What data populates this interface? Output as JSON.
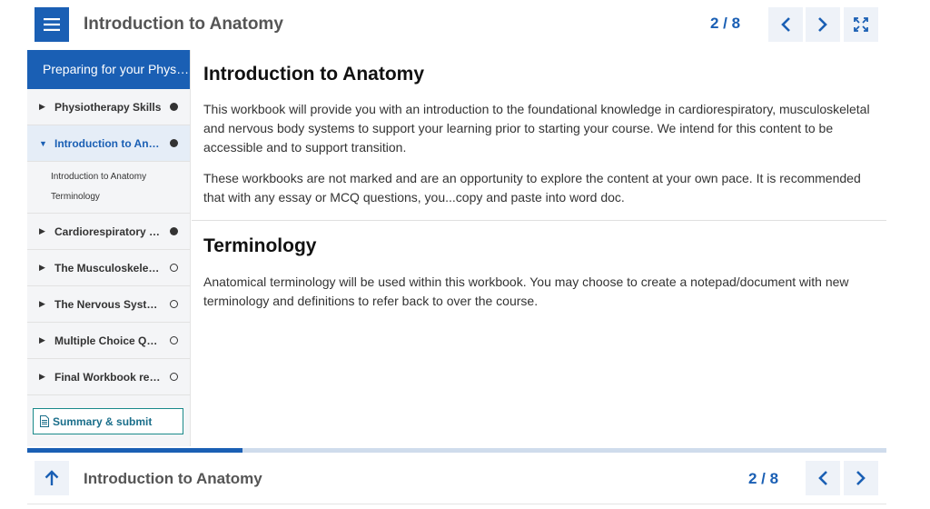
{
  "header": {
    "title": "Introduction to Anatomy",
    "counter": "2 / 8"
  },
  "sidebar": {
    "heading": "Preparing for your Physiotherapy degree",
    "items": [
      {
        "label": "Physiotherapy Skills",
        "status": "complete",
        "expanded": false
      },
      {
        "label": "Introduction to Anatomy",
        "status": "complete",
        "expanded": true,
        "active": true
      },
      {
        "label": "Cardiorespiratory System",
        "status": "complete",
        "expanded": false
      },
      {
        "label": "The Musculoskeletal System",
        "status": "incomplete",
        "expanded": false
      },
      {
        "label": "The Nervous System",
        "status": "incomplete",
        "expanded": false
      },
      {
        "label": "Multiple Choice Questions",
        "status": "incomplete",
        "expanded": false
      },
      {
        "label": "Final Workbook reflection",
        "status": "incomplete",
        "expanded": false
      }
    ],
    "subitems": [
      "Introduction to Anatomy",
      "Terminology"
    ],
    "summary_label": "Summary & submit"
  },
  "content": {
    "section1": {
      "heading": "Introduction to Anatomy",
      "p1": "This workbook will provide you with an introduction to the foundational knowledge in cardiorespiratory, musculoskeletal and nervous body systems to support your learning prior to starting your course. We intend for this content to be accessible and to support transition.",
      "p2": "These workbooks are not marked and are an opportunity to explore the content at your own pace. It is recommended that with any essay or MCQ questions, you...copy and paste into word doc."
    },
    "section2": {
      "heading": "Terminology",
      "p1": "Anatomical terminology will be used within this workbook. You may choose to create a notepad/document with new terminology and definitions to refer back to over the course."
    }
  },
  "progress": {
    "value": 0.25
  },
  "footer": {
    "title": "Introduction to Anatomy",
    "counter": "2 / 8"
  },
  "colors": {
    "accent": "#1a5fb4",
    "progress_track": "#cfdcec"
  },
  "icons": {
    "menu": "hamburger-menu-icon",
    "prev": "chevron-left-icon",
    "next": "chevron-right-icon",
    "fullscreen": "expand-icon",
    "up": "arrow-up-icon",
    "summary": "document-icon"
  }
}
